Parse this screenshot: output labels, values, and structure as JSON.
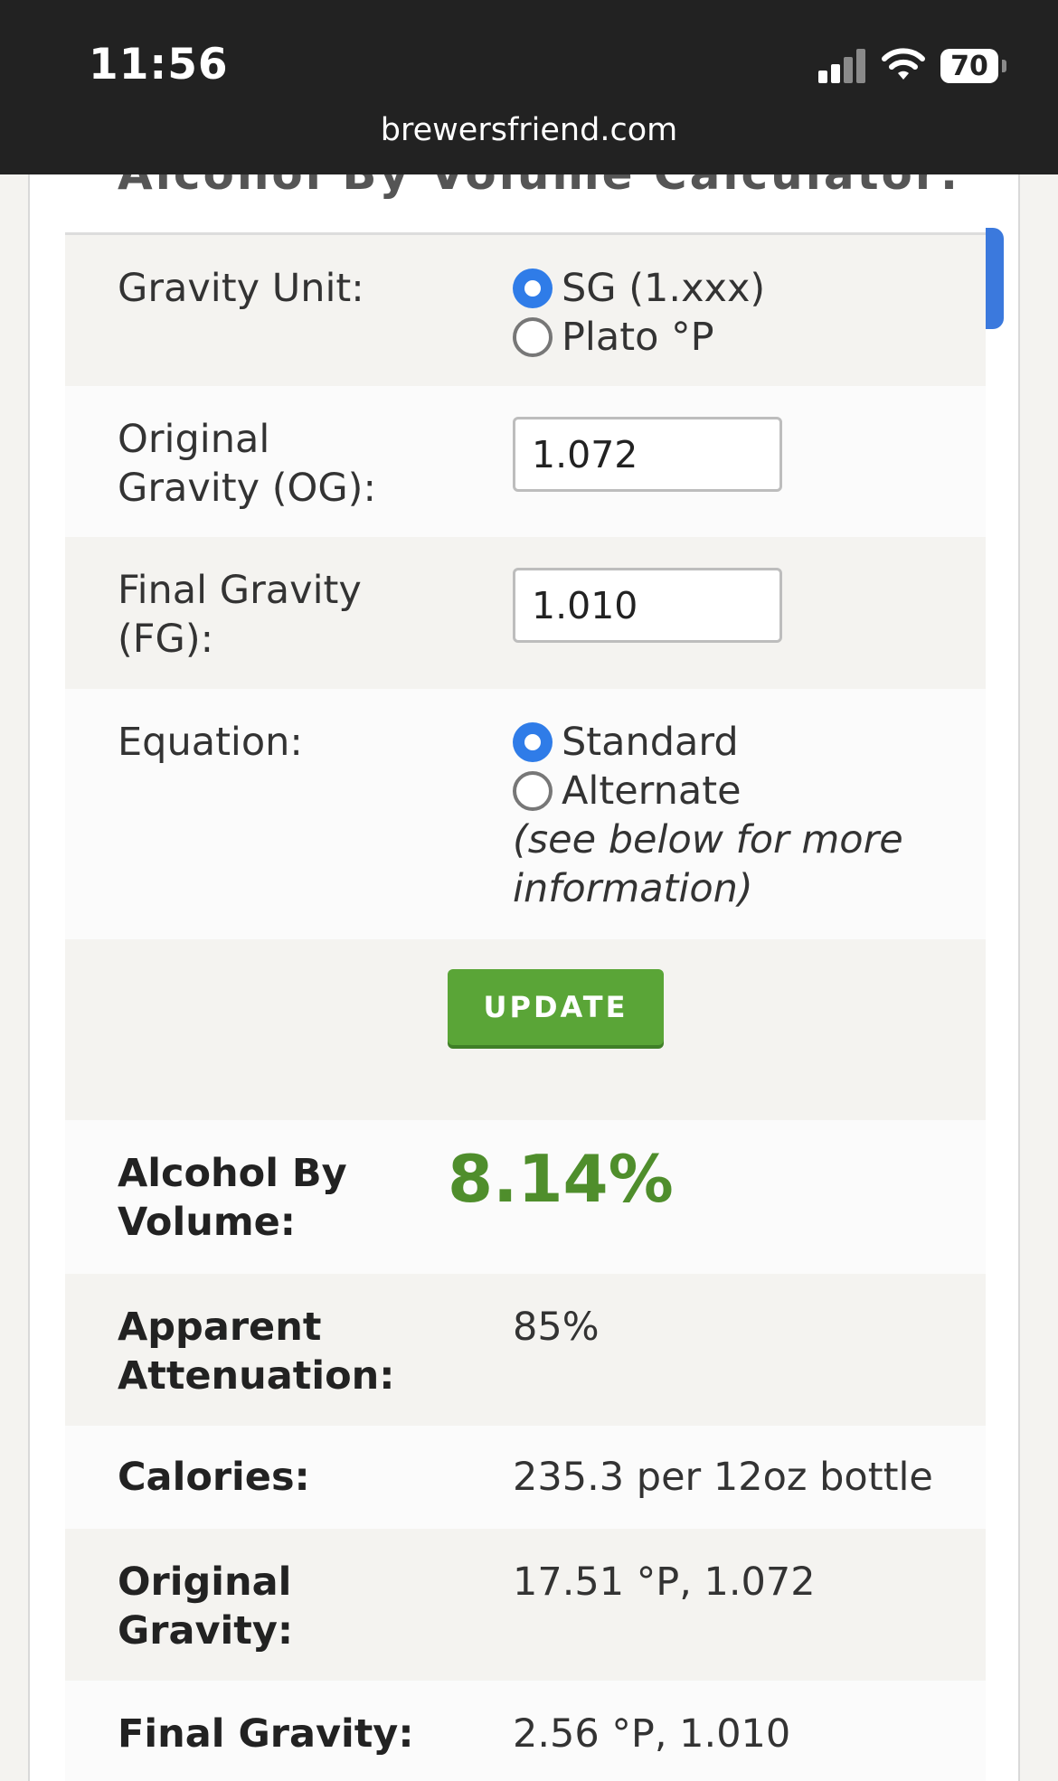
{
  "status_bar": {
    "time": "11:56",
    "battery": "70"
  },
  "address_bar": {
    "url": "brewersfriend.com"
  },
  "calculator": {
    "title": "Alcohol By Volume Calculator:",
    "gravity_unit": {
      "label": "Gravity Unit:",
      "options": [
        "SG (1.xxx)",
        "Plato °P"
      ],
      "selected": "SG (1.xxx)"
    },
    "original_gravity": {
      "label_line1": "Original",
      "label_line2": "Gravity (OG):",
      "value": "1.072"
    },
    "final_gravity": {
      "label_line1": "Final Gravity",
      "label_line2": "(FG):",
      "value": "1.010"
    },
    "equation": {
      "label": "Equation:",
      "options": [
        "Standard",
        "Alternate"
      ],
      "selected": "Standard",
      "note_line1": "(see below for more",
      "note_line2": "information)"
    },
    "update_label": "UPDATE"
  },
  "results": {
    "abv": {
      "label_line1": "Alcohol By",
      "label_line2": "Volume:",
      "value": "8.14%"
    },
    "attenuation": {
      "label_line1": "Apparent",
      "label_line2": "Attenuation:",
      "value": "85%"
    },
    "calories": {
      "label": "Calories:",
      "value": "235.3 per 12oz bottle"
    },
    "original_gravity": {
      "label_line1": "Original",
      "label_line2": "Gravity:",
      "value": "17.51 °P, 1.072"
    },
    "final_gravity": {
      "label": "Final Gravity:",
      "value": "2.56 °P, 1.010"
    }
  },
  "colors": {
    "accent_green": "#5aa537",
    "result_green": "#4f8e2c",
    "radio_blue": "#2f7ce8",
    "topbar": "#222222"
  }
}
